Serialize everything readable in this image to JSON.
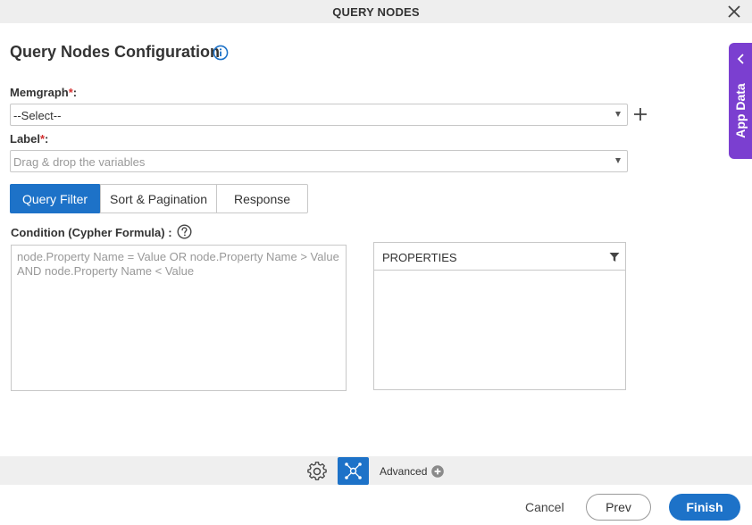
{
  "window": {
    "title": "QUERY NODES",
    "close_icon": "close-icon"
  },
  "heading": {
    "title": "Query Nodes Configuration",
    "info_icon": "info-icon"
  },
  "memgraph": {
    "label": "Memgraph",
    "required_mark": "*",
    "label_suffix": ":",
    "value": "--Select--",
    "add_icon": "plus-icon"
  },
  "label_field": {
    "label": "Label",
    "required_mark": "*",
    "label_suffix": ":",
    "placeholder": "Drag & drop the variables"
  },
  "tabs": [
    {
      "label": "Query Filter",
      "active": true
    },
    {
      "label": "Sort & Pagination",
      "active": false
    },
    {
      "label": "Response",
      "active": false
    }
  ],
  "condition": {
    "label": "Condition (Cypher Formula) :",
    "placeholder": "node.Property Name = Value OR node.Property Name > Value AND node.Property Name < Value",
    "help_icon": "help-icon"
  },
  "properties": {
    "header": "PROPERTIES",
    "filter_icon": "filter-icon"
  },
  "app_data": {
    "label": "App Data",
    "icon": "chevron-left-icon"
  },
  "toolbar": {
    "advanced_label": "Advanced",
    "gear_icon": "gear-icon",
    "advanced_icon": "advanced-settings-icon",
    "add_icon": "plus-circle-icon"
  },
  "footer": {
    "cancel": "Cancel",
    "prev": "Prev",
    "finish": "Finish"
  },
  "colors": {
    "primary": "#1d72c8",
    "app_data_tab": "#7b3fd0",
    "required": "#d32f2f"
  }
}
